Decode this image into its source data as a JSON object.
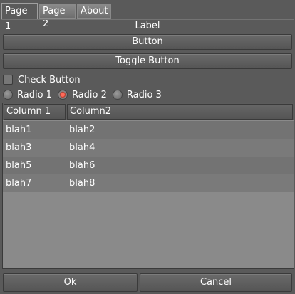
{
  "tabs": [
    "Page 1",
    "Page 2",
    "About"
  ],
  "label": "Label",
  "button_label": "Button",
  "toggle_button_label": "Toggle Button",
  "check_button_label": "Check Button",
  "radios": [
    {
      "label": "Radio 1",
      "checked": false
    },
    {
      "label": "Radio 2",
      "checked": true
    },
    {
      "label": "Radio 3",
      "checked": false
    }
  ],
  "table": {
    "columns": [
      "Column 1",
      "Column2"
    ],
    "rows": [
      [
        "blah1",
        "blah2"
      ],
      [
        "blah3",
        "blah4"
      ],
      [
        "blah5",
        "blah6"
      ],
      [
        "blah7",
        "blah8"
      ]
    ]
  },
  "footer": {
    "ok_label": "Ok",
    "cancel_label": "Cancel"
  },
  "colors": {
    "background": "#5a5a5a",
    "radio_selected": "#e2412f",
    "table_bg": "#8a8a8a"
  }
}
